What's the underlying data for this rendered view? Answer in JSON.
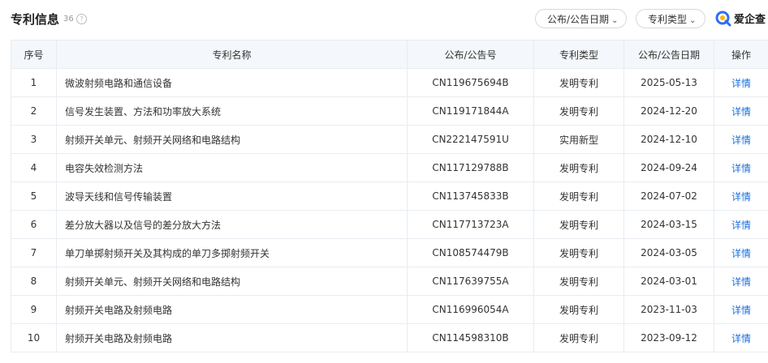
{
  "header": {
    "title": "专利信息",
    "count": "36",
    "help_glyph": "?",
    "filter_date_label": "公布/公告日期",
    "filter_type_label": "专利类型",
    "logo_text": "爱企查",
    "logo_icon": "aiqicha-logo-icon",
    "accent_color": "#1a6fdf"
  },
  "table": {
    "columns": [
      "序号",
      "专利名称",
      "公布/公告号",
      "专利类型",
      "公布/公告日期",
      "操作"
    ],
    "rows": [
      {
        "index": "1",
        "name": "微波射频电路和通信设备",
        "number": "CN119675694B",
        "type": "发明专利",
        "date": "2025-05-13",
        "action": "详情"
      },
      {
        "index": "2",
        "name": "信号发生装置、方法和功率放大系统",
        "number": "CN119171844A",
        "type": "发明专利",
        "date": "2024-12-20",
        "action": "详情"
      },
      {
        "index": "3",
        "name": "射频开关单元、射频开关网络和电路结构",
        "number": "CN222147591U",
        "type": "实用新型",
        "date": "2024-12-10",
        "action": "详情"
      },
      {
        "index": "4",
        "name": "电容失效检测方法",
        "number": "CN117129788B",
        "type": "发明专利",
        "date": "2024-09-24",
        "action": "详情"
      },
      {
        "index": "5",
        "name": "波导天线和信号传输装置",
        "number": "CN113745833B",
        "type": "发明专利",
        "date": "2024-07-02",
        "action": "详情"
      },
      {
        "index": "6",
        "name": "差分放大器以及信号的差分放大方法",
        "number": "CN117713723A",
        "type": "发明专利",
        "date": "2024-03-15",
        "action": "详情"
      },
      {
        "index": "7",
        "name": "单刀单掷射频开关及其构成的单刀多掷射频开关",
        "number": "CN108574479B",
        "type": "发明专利",
        "date": "2024-03-05",
        "action": "详情"
      },
      {
        "index": "8",
        "name": "射频开关单元、射频开关网络和电路结构",
        "number": "CN117639755A",
        "type": "发明专利",
        "date": "2024-03-01",
        "action": "详情"
      },
      {
        "index": "9",
        "name": "射频开关电路及射频电路",
        "number": "CN116996054A",
        "type": "发明专利",
        "date": "2023-11-03",
        "action": "详情"
      },
      {
        "index": "10",
        "name": "射频开关电路及射频电路",
        "number": "CN114598310B",
        "type": "发明专利",
        "date": "2023-09-12",
        "action": "详情"
      }
    ]
  }
}
